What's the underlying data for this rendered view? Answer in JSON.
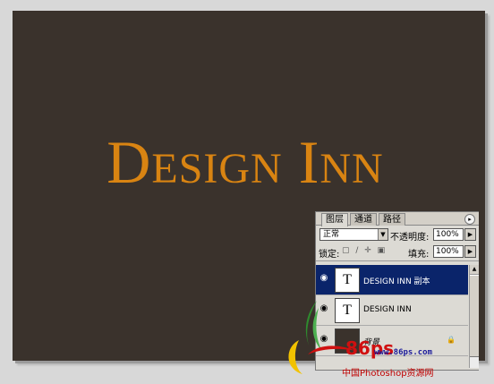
{
  "canvas": {
    "headline": "Design Inn",
    "background_color": "#3a322c",
    "text_color": "#d98412"
  },
  "layers_panel": {
    "tabs": [
      "图层",
      "通道",
      "路径"
    ],
    "blend_mode": "正常",
    "opacity_label": "不透明度:",
    "opacity_value": "100%",
    "lock_label": "锁定:",
    "fill_label": "填充:",
    "fill_value": "100%",
    "layers": [
      {
        "thumb": "T",
        "name": "DESIGN INN 副本",
        "selected": true
      },
      {
        "thumb": "T",
        "name": "DESIGN INN",
        "selected": false
      },
      {
        "thumb": "",
        "name": "背景",
        "selected": false
      }
    ],
    "selected_color": "#0a246a"
  },
  "watermark": {
    "logo_text": "86ps",
    "url": "www.86ps.com",
    "caption": "中国Photoshop资源网"
  }
}
